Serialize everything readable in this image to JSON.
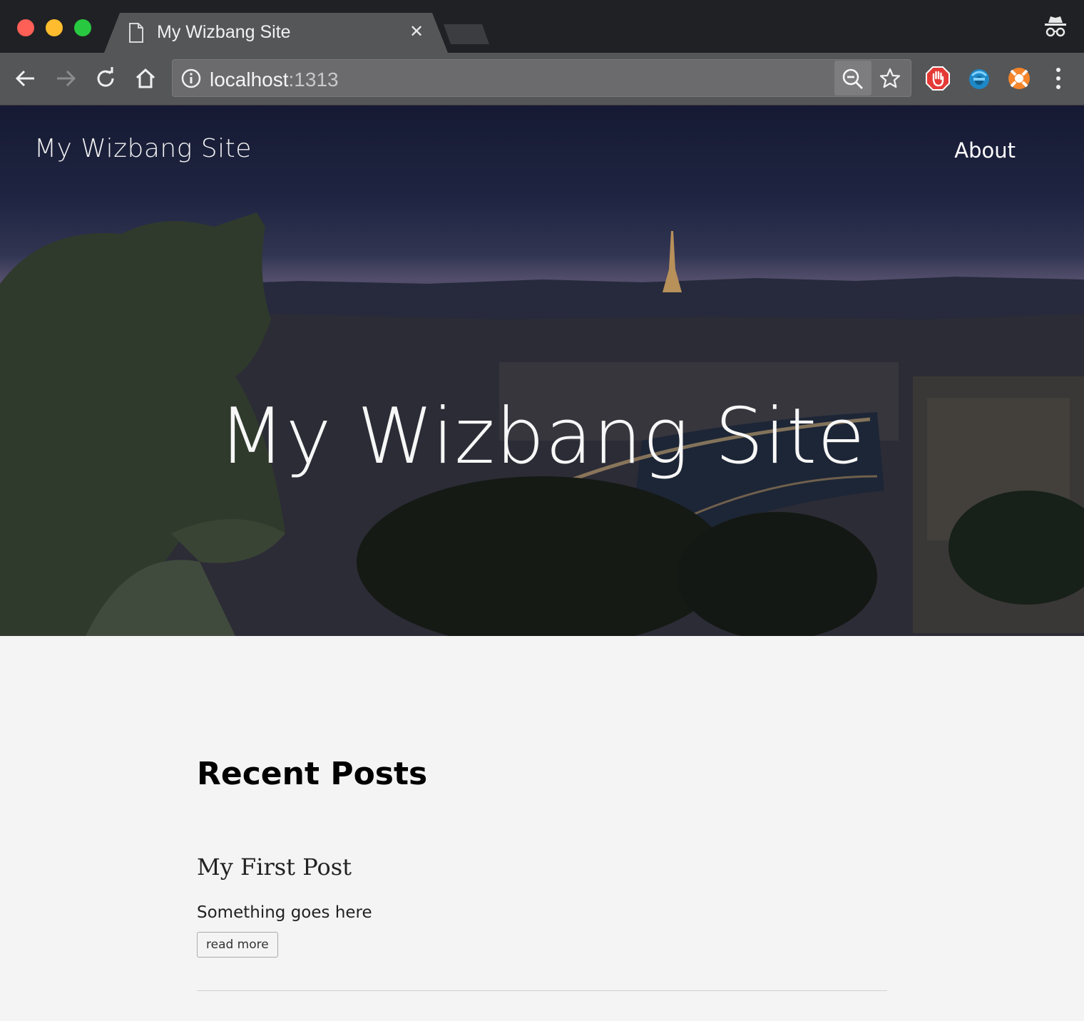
{
  "browser": {
    "tab_title": "My Wizbang Site",
    "url_host": "localhost",
    "url_port": ":1313"
  },
  "site": {
    "brand": "My Wizbang Site",
    "nav": {
      "about": "About"
    },
    "hero_title": "My Wizbang Site"
  },
  "main": {
    "heading": "Recent Posts",
    "posts": [
      {
        "title": "My First Post",
        "summary": "Something goes here",
        "read_more": "read more"
      }
    ]
  },
  "colors": {
    "titlebar": "#202124",
    "toolbar": "#555658",
    "page_background": "#f4f4f4"
  }
}
